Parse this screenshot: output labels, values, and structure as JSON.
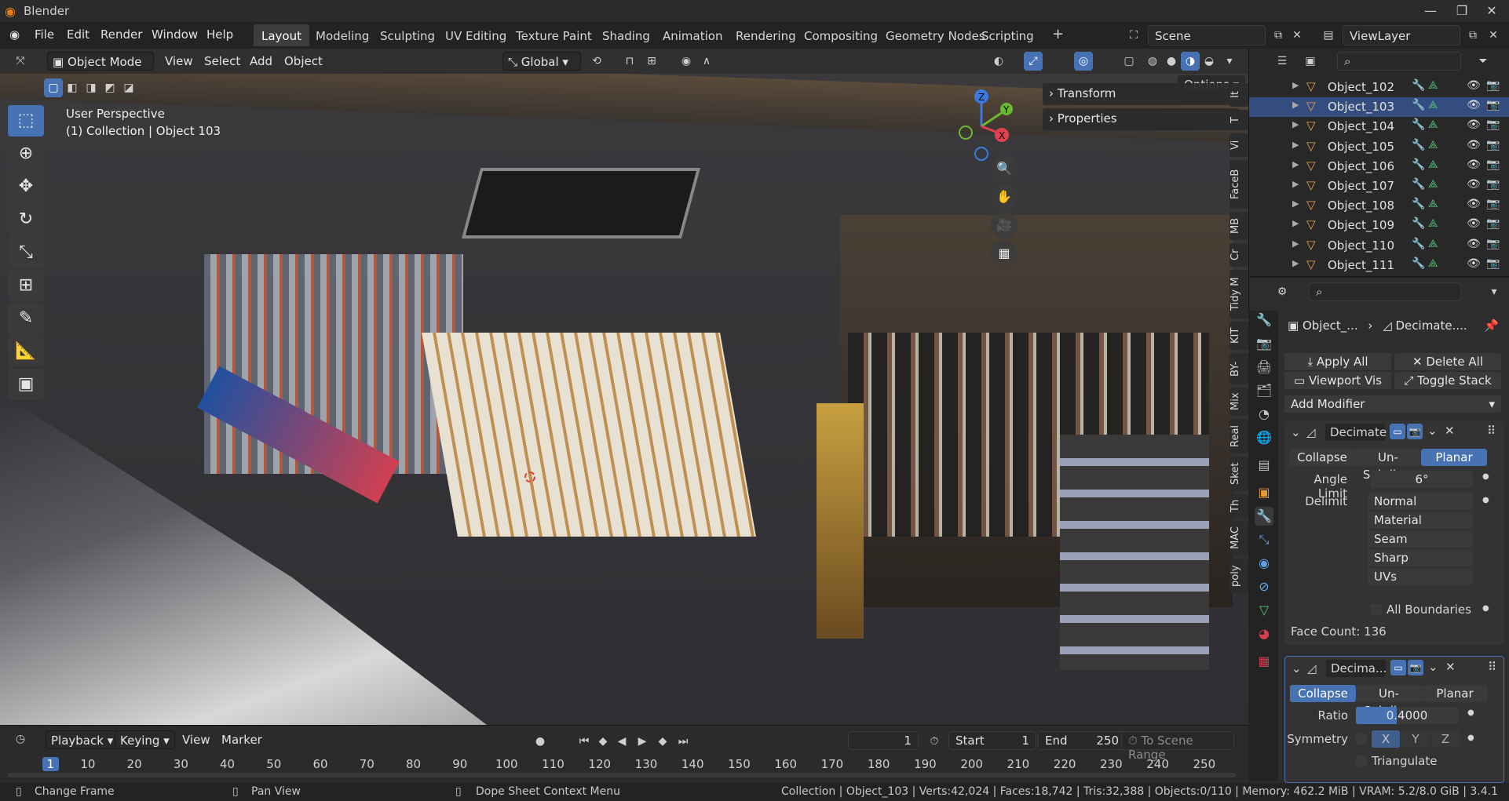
{
  "window": {
    "title": "Blender"
  },
  "menu": [
    "File",
    "Edit",
    "Render",
    "Window",
    "Help"
  ],
  "workspaces": [
    "Layout",
    "Modeling",
    "Sculpting",
    "UV Editing",
    "Texture Paint",
    "Shading",
    "Animation",
    "Rendering",
    "Compositing",
    "Geometry Nodes",
    "Scripting"
  ],
  "scene": {
    "name": "Scene",
    "view_layer": "ViewLayer"
  },
  "viewport": {
    "mode": "Object Mode",
    "menus": [
      "View",
      "Select",
      "Add",
      "Object"
    ],
    "orientation": "Global",
    "options_label": "Options",
    "perspective_label": "User Perspective",
    "collection_label": "(1) Collection | Object 103",
    "npanel": [
      "Transform",
      "Properties"
    ],
    "side_tabs": [
      "It",
      "T",
      "Vi",
      "FaceB",
      "MB",
      "Cr",
      "Tidy M",
      "KIT",
      "BY-",
      "Mix",
      "Real",
      "Sket",
      "Th",
      "MAC",
      "poly"
    ]
  },
  "outliner": {
    "items": [
      {
        "name": "Object_102",
        "selected": false
      },
      {
        "name": "Object_103",
        "selected": true
      },
      {
        "name": "Object_104",
        "selected": false
      },
      {
        "name": "Object_105",
        "selected": false
      },
      {
        "name": "Object_106",
        "selected": false
      },
      {
        "name": "Object_107",
        "selected": false
      },
      {
        "name": "Object_108",
        "selected": false
      },
      {
        "name": "Object_109",
        "selected": false
      },
      {
        "name": "Object_110",
        "selected": false
      },
      {
        "name": "Object_111",
        "selected": false
      }
    ]
  },
  "properties": {
    "breadcrumb_object": "Object_...",
    "breadcrumb_modifier": "Decimate....",
    "apply_all": "Apply All",
    "delete_all": "Delete All",
    "viewport_vis": "Viewport Vis",
    "toggle_stack": "Toggle Stack",
    "add_modifier": "Add Modifier",
    "mod1": {
      "name": "Decimate",
      "tabs": [
        "Collapse",
        "Un-Subdiv...",
        "Planar"
      ],
      "active_tab": "Planar",
      "angle_limit_label": "Angle Limit",
      "angle_limit": "6°",
      "delimit_label": "Delimit",
      "delimit_options": [
        "Normal",
        "Material",
        "Seam",
        "Sharp",
        "UVs"
      ],
      "all_boundaries": "All Boundaries",
      "face_count": "Face Count: 136"
    },
    "mod2": {
      "name": "Decima...",
      "tabs": [
        "Collapse",
        "Un-Subdiv...",
        "Planar"
      ],
      "active_tab": "Collapse",
      "ratio_label": "Ratio",
      "ratio": "0.4000",
      "symmetry_label": "Symmetry",
      "axes": [
        "X",
        "Y",
        "Z"
      ],
      "triangulate": "Triangulate"
    }
  },
  "timeline": {
    "menus": [
      "Playback",
      "Keying",
      "View",
      "Marker"
    ],
    "current_frame": "1",
    "start_label": "Start",
    "start": "1",
    "end_label": "End",
    "end": "250",
    "to_scene_range": "To Scene Range",
    "ticks": [
      "1",
      "10",
      "20",
      "30",
      "40",
      "50",
      "60",
      "70",
      "80",
      "90",
      "100",
      "110",
      "120",
      "130",
      "140",
      "150",
      "160",
      "170",
      "180",
      "190",
      "200",
      "210",
      "220",
      "230",
      "240",
      "250"
    ]
  },
  "statusbar": {
    "left1": "Change Frame",
    "left2": "Pan View",
    "left3": "Dope Sheet Context Menu",
    "right": "Collection | Object_103 | Verts:42,024 | Faces:18,742 | Tris:32,388 | Objects:0/110 | Memory: 462.2 MiB | VRAM: 5.2/8.0 GiB | 3.4.1"
  }
}
